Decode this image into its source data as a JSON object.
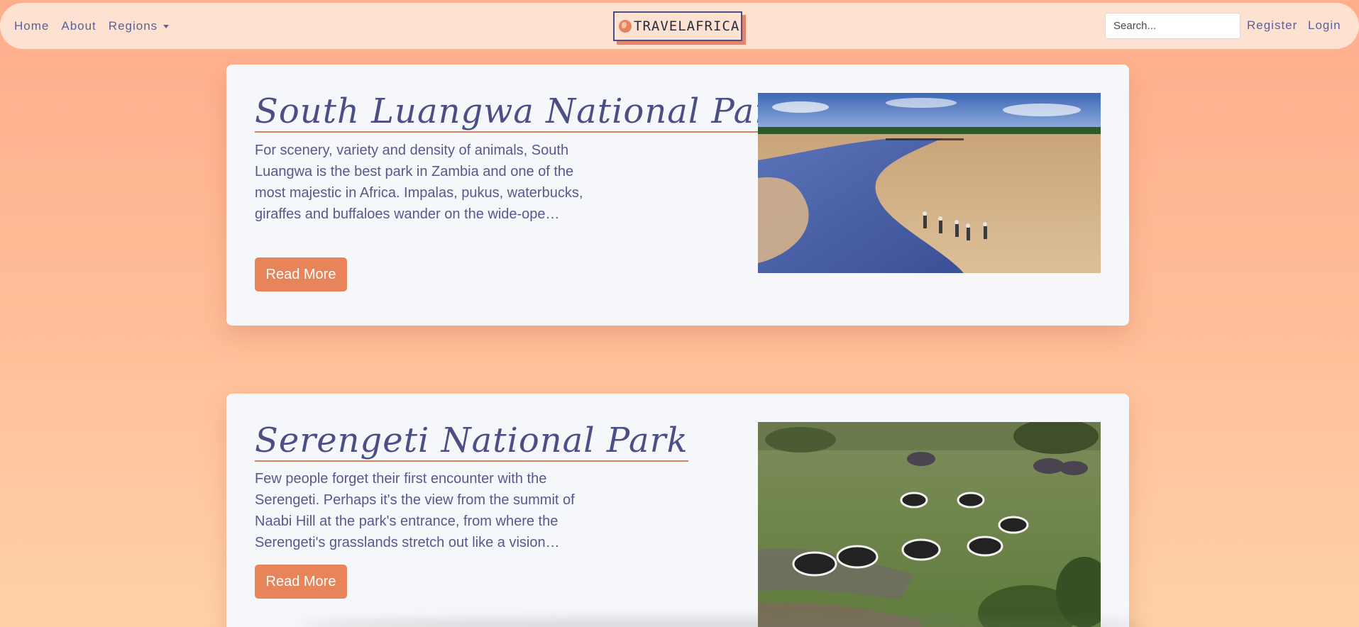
{
  "nav": {
    "home": "Home",
    "about": "About",
    "regions": "Regions",
    "brand": "TRAVELAFRICA",
    "search_placeholder": "Search...",
    "register": "Register",
    "login": "Login"
  },
  "cards": [
    {
      "title": "South Luangwa National Park",
      "text": "For scenery, variety and density of animals, South Luangwa is the best park in Zambia and one of the most majestic in Africa. Impalas, pukus, waterbucks, giraffes and buffaloes wander on the wide-ope…",
      "button": "Read More",
      "image": "river-walking-safari-photo"
    },
    {
      "title": "Serengeti National Park",
      "text": "Few people forget their first encounter with the Serengeti. Perhaps it's the view from the summit of Naabi Hill at the park's entrance, from where the Serengeti's grasslands stretch out like a vision…",
      "button": "Read More",
      "image": "zebras-at-waterhole-photo"
    }
  ],
  "colors": {
    "accent": "#e8845a",
    "text": "#55598f",
    "navbar": "#fde2d2",
    "card": "#f6f7fa"
  }
}
